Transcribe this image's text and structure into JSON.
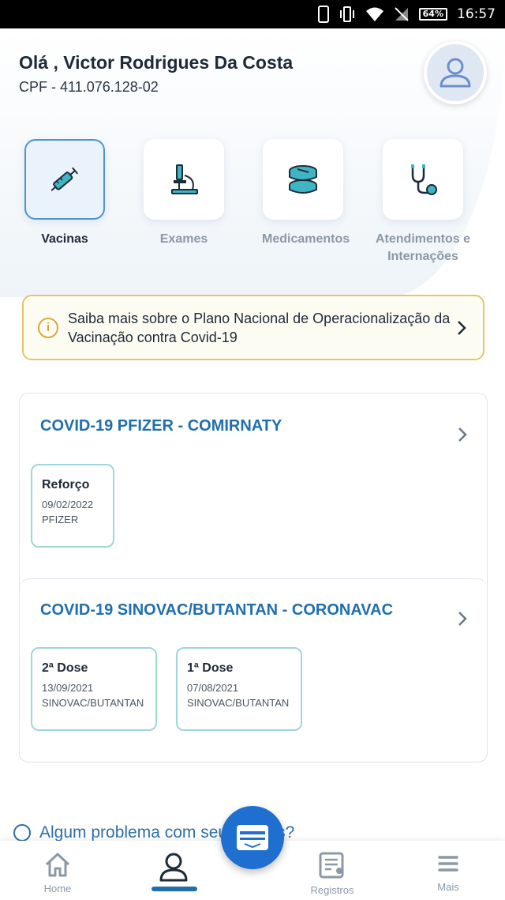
{
  "status_bar": {
    "battery": "64%",
    "time": "16:57"
  },
  "header": {
    "greeting": "Olá , Victor Rodrigues Da Costa",
    "cpf": "CPF - 411.076.128-02"
  },
  "categories": [
    {
      "label": "Vacinas",
      "icon": "syringe-icon",
      "active": true
    },
    {
      "label": "Exames",
      "icon": "microscope-icon",
      "active": false
    },
    {
      "label": "Medicamentos",
      "icon": "pills-icon",
      "active": false
    },
    {
      "label": "Atendimentos e Internações",
      "icon": "stethoscope-icon",
      "active": false
    }
  ],
  "banner": {
    "text": "Saiba mais sobre o Plano Nacional de Operacionalização da Vacinação contra Covid-19"
  },
  "vaccines": [
    {
      "title": "COVID-19 PFIZER - COMIRNATY",
      "doses": [
        {
          "name": "Reforço",
          "date": "09/02/2022",
          "manufacturer": "PFIZER"
        }
      ]
    },
    {
      "title": "COVID-19 SINOVAC/BUTANTAN - CORONAVAC",
      "doses": [
        {
          "name": "2ª Dose",
          "date": "13/09/2021",
          "manufacturer": "SINOVAC/BUTANTAN"
        },
        {
          "name": "1ª Dose",
          "date": "07/08/2021",
          "manufacturer": "SINOVAC/BUTANTAN"
        }
      ]
    }
  ],
  "help": {
    "text": "Algum problema com seus dados?"
  },
  "bottom_nav": {
    "items": [
      {
        "label": "Home",
        "icon": "home-icon"
      },
      {
        "label": "",
        "icon": "user-icon"
      },
      {
        "label": "Registros",
        "icon": "registry-icon"
      },
      {
        "label": "Mais",
        "icon": "menu-icon"
      }
    ]
  },
  "colors": {
    "primary": "#1f6fad",
    "fab": "#1f6fd0",
    "banner_border": "#e6c56a",
    "dose_border": "#9fd6dc"
  }
}
